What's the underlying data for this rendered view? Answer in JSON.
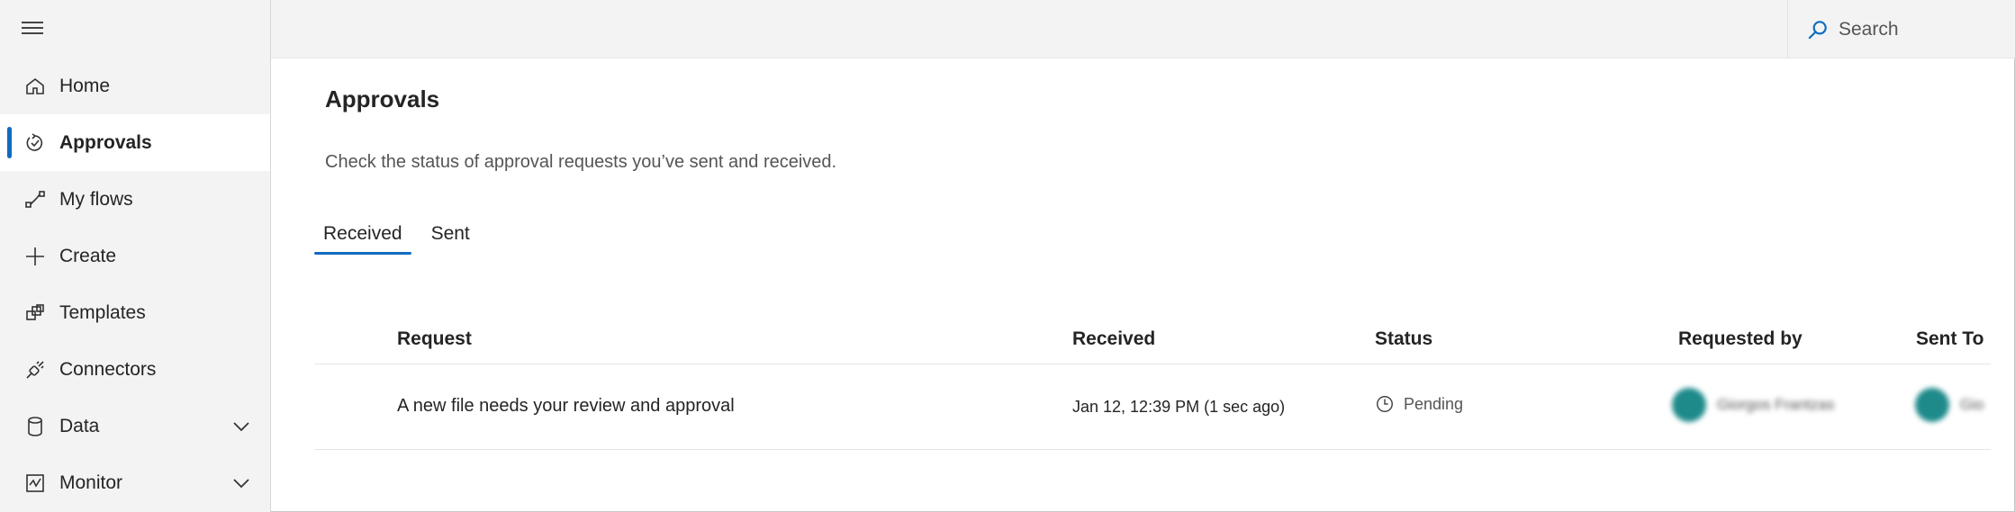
{
  "sidebar": {
    "items": [
      {
        "label": "Home",
        "icon": "home-icon"
      },
      {
        "label": "Approvals",
        "icon": "approvals-icon",
        "active": true
      },
      {
        "label": "My flows",
        "icon": "flows-icon"
      },
      {
        "label": "Create",
        "icon": "plus-icon"
      },
      {
        "label": "Templates",
        "icon": "templates-icon"
      },
      {
        "label": "Connectors",
        "icon": "connectors-icon"
      },
      {
        "label": "Data",
        "icon": "database-icon",
        "expandable": true
      },
      {
        "label": "Monitor",
        "icon": "monitor-icon",
        "expandable": true
      }
    ]
  },
  "topbar": {
    "search_label": "Search"
  },
  "main": {
    "title": "Approvals",
    "subtitle": "Check the status of approval requests you’ve sent and received.",
    "tabs": [
      {
        "label": "Received",
        "active": true
      },
      {
        "label": "Sent"
      }
    ],
    "table": {
      "headers": {
        "request": "Request",
        "received": "Received",
        "status": "Status",
        "requested_by": "Requested by",
        "sent_to": "Sent To"
      },
      "rows": [
        {
          "request": "A new file needs your review and approval",
          "received": "Jan 12, 12:39 PM (1 sec ago)",
          "status": "Pending",
          "requested_by": "Giorgos Frantzas",
          "sent_to": "Gio"
        }
      ]
    }
  },
  "colors": {
    "accent": "#0f6cbd",
    "sidebar_bg": "#f3f3f3",
    "avatar": "#1f8a8a"
  }
}
